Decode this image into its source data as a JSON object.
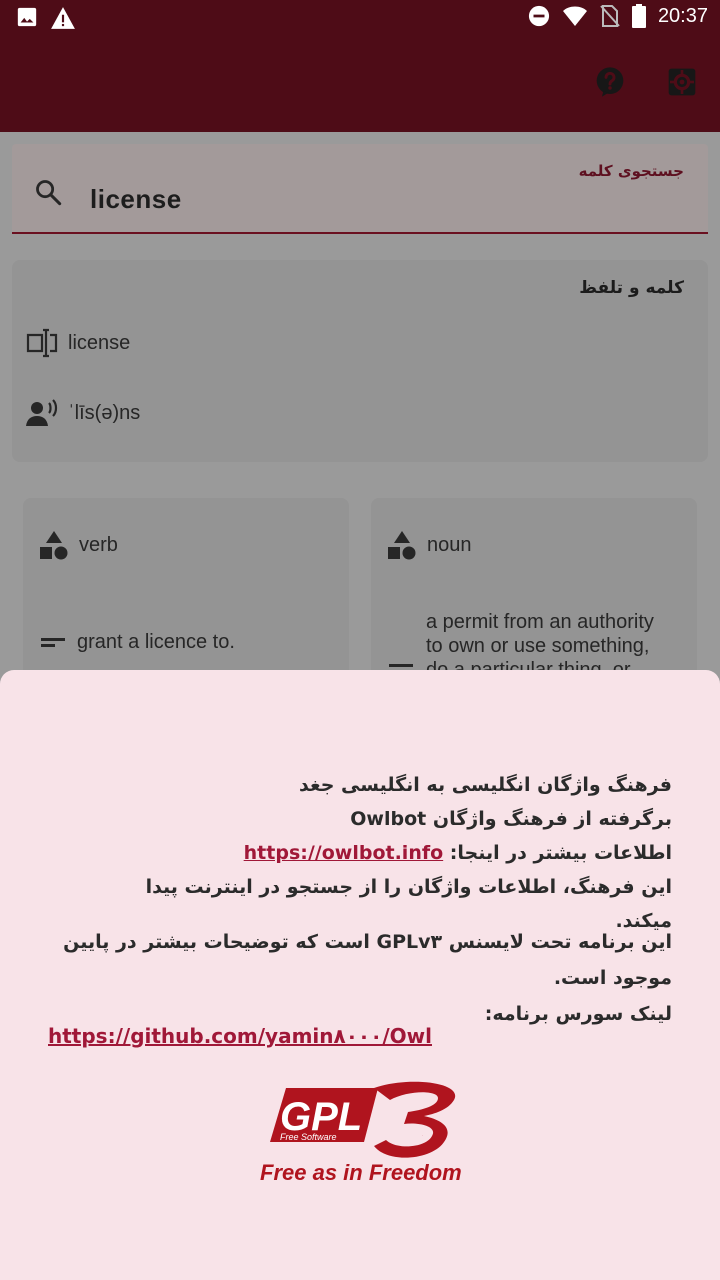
{
  "status_bar": {
    "time": "20:37",
    "icons": [
      "image-icon",
      "warning-icon",
      "do-not-disturb-icon",
      "wifi-icon",
      "no-sim-icon",
      "battery-icon"
    ]
  },
  "app_bar": {
    "icons": [
      "help-icon",
      "settings-icon"
    ],
    "color": "#4e0c17"
  },
  "search": {
    "label": "جستجوی کلمه",
    "value": "license"
  },
  "word_card": {
    "title": "کلمه و تلفظ",
    "word": "license",
    "pronunciation": "ˈlīs(ə)ns"
  },
  "cards": [
    {
      "pos": "verb",
      "definition": "grant a licence to."
    },
    {
      "pos": "noun",
      "definition_lines": [
        "a permit from an authority",
        "to own or use something,",
        "do a particular thing, or"
      ]
    }
  ],
  "about": {
    "line1": "فرهنگ واژگان انگلیسی به انگلیسی جغد",
    "line2": "برگرفته از فرهنگ واژگان Owlbot",
    "line3_prefix": "اطلاعات بیشتر در اینجا:",
    "line3_link": "https://owlbot.info",
    "line4": "این فرهنگ، اطلاعات واژگان را از جستجو در اینترنت پیدا میکند.",
    "license_text": "این برنامه تحت لایسنس GPLv۳ است که توضیحات بیشتر در پایین موجود است.",
    "source_label": "لینک سورس برنامه:",
    "github_link": "https://github.com/yamin۸۰۰۰/Owl",
    "gpl_logo": {
      "mark": "GPL",
      "version": "3",
      "subtitle": "Free Software",
      "tagline": "Free as in Freedom"
    }
  },
  "colors": {
    "primary": "#4e0c17",
    "accent": "#a01838",
    "sheet_bg": "#f8e3e8"
  }
}
